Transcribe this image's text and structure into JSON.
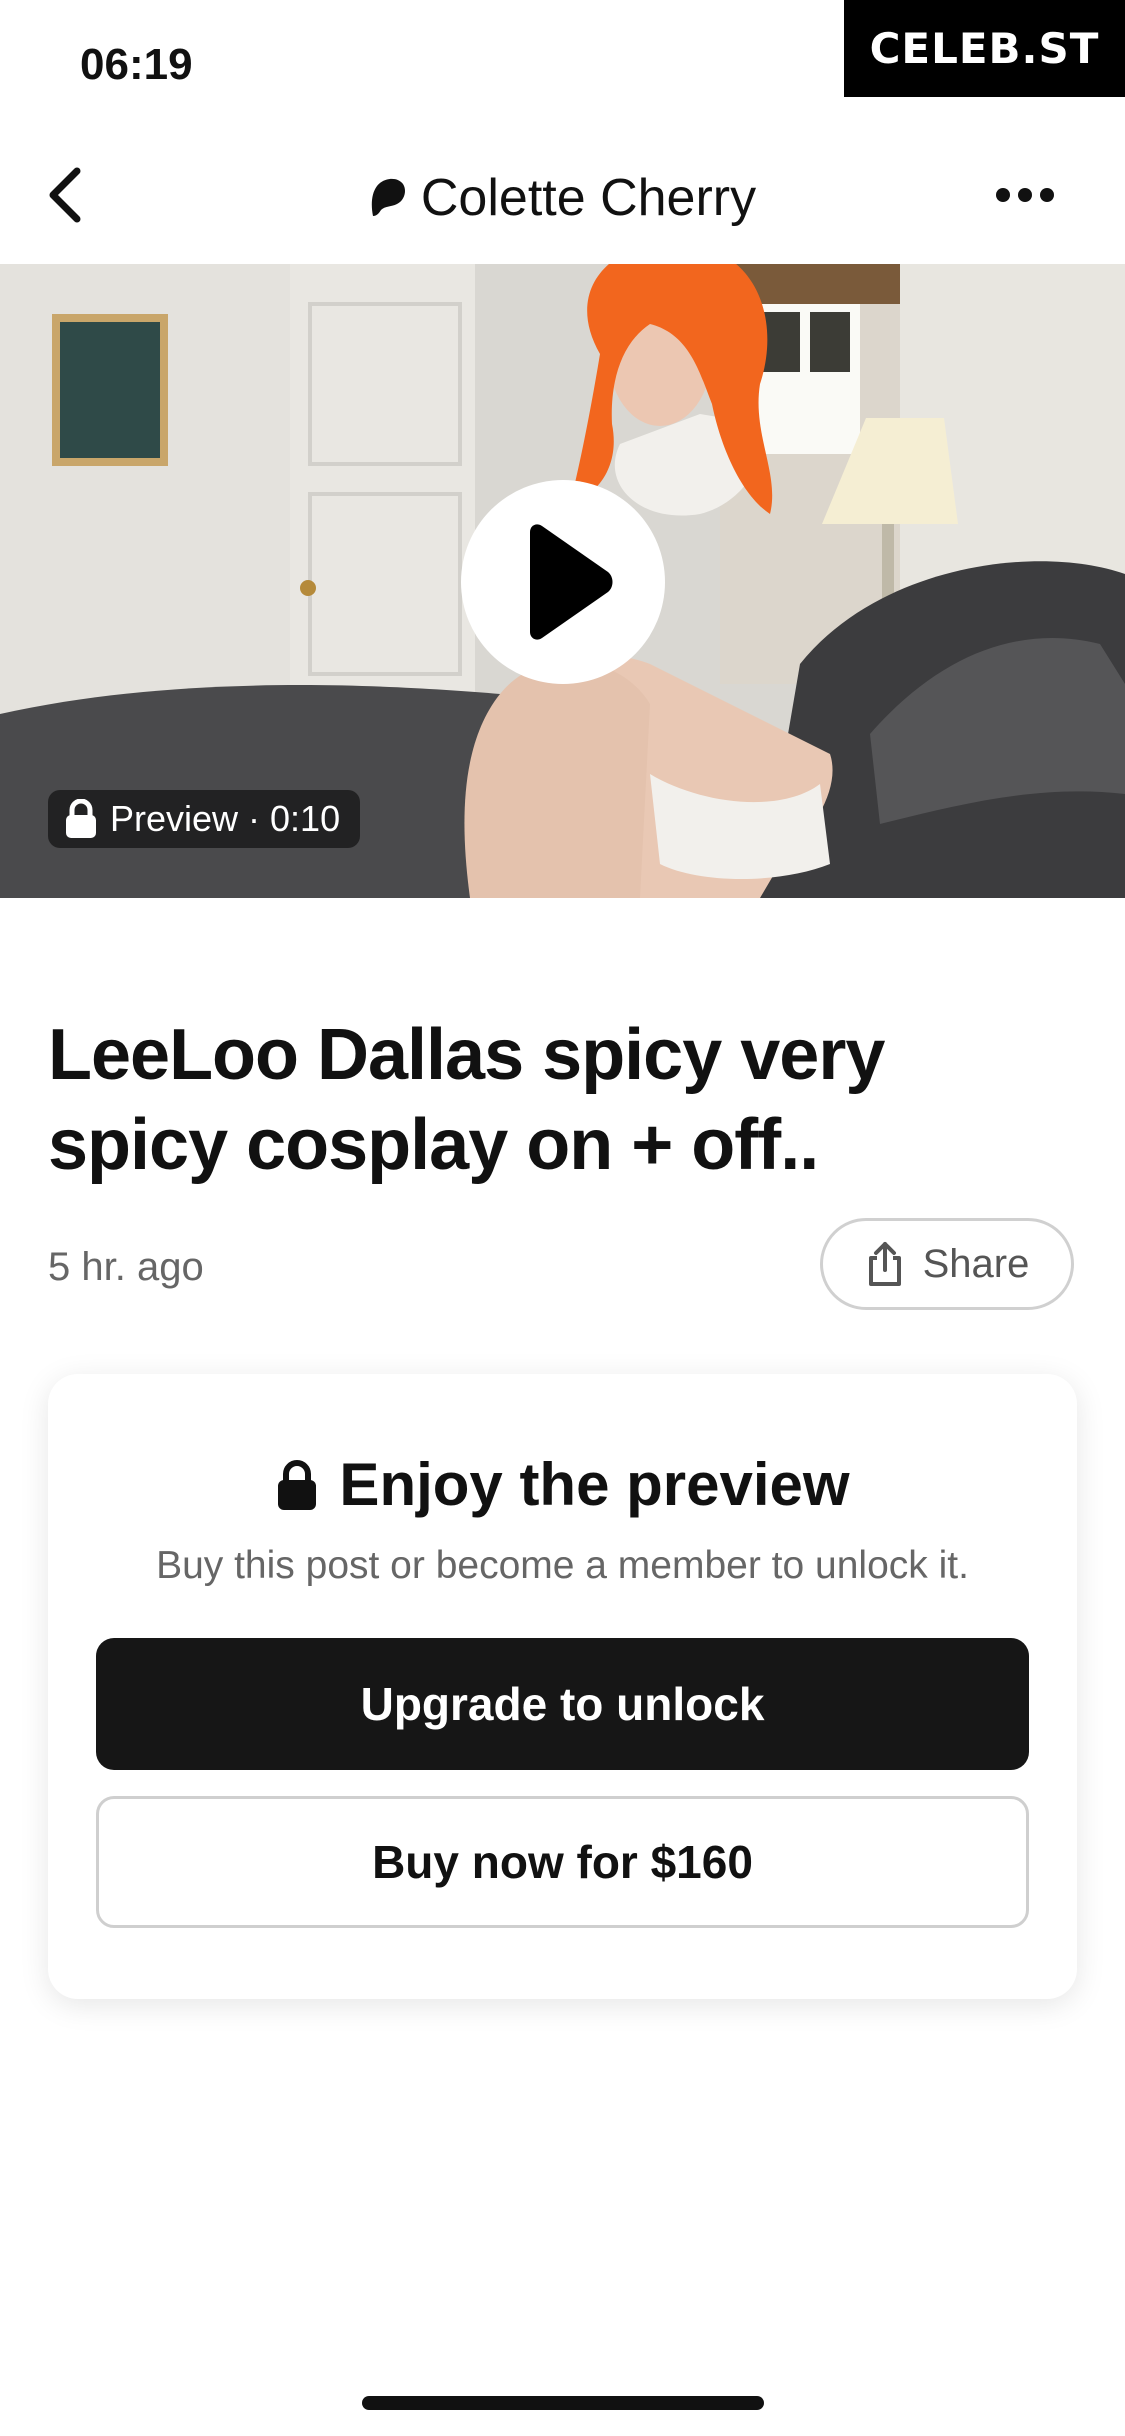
{
  "status_bar": {
    "time": "06:19"
  },
  "watermark": "CELEB.ST",
  "header": {
    "creator_name": "Colette Cherry",
    "back_icon": "chevron-left-icon",
    "more_icon": "more-horizontal-icon",
    "logo_icon": "patreon-logo-icon"
  },
  "media": {
    "preview_label": "Preview · 0:10",
    "lock_icon": "lock-icon",
    "play_icon": "play-icon"
  },
  "post": {
    "title": "LeeLoo Dallas spicy very spicy cosplay on + off..",
    "time_ago": "5 hr. ago",
    "share_label": "Share",
    "share_icon": "share-icon"
  },
  "unlock_card": {
    "heading": "Enjoy the preview",
    "subtext": "Buy this post or become a member to unlock it.",
    "upgrade_label": "Upgrade to unlock",
    "buy_label": "Buy now for $160"
  },
  "colors": {
    "primary_button": "#161616",
    "text_primary": "#111111",
    "text_secondary": "#666666",
    "hair_accent": "#f2661e"
  }
}
